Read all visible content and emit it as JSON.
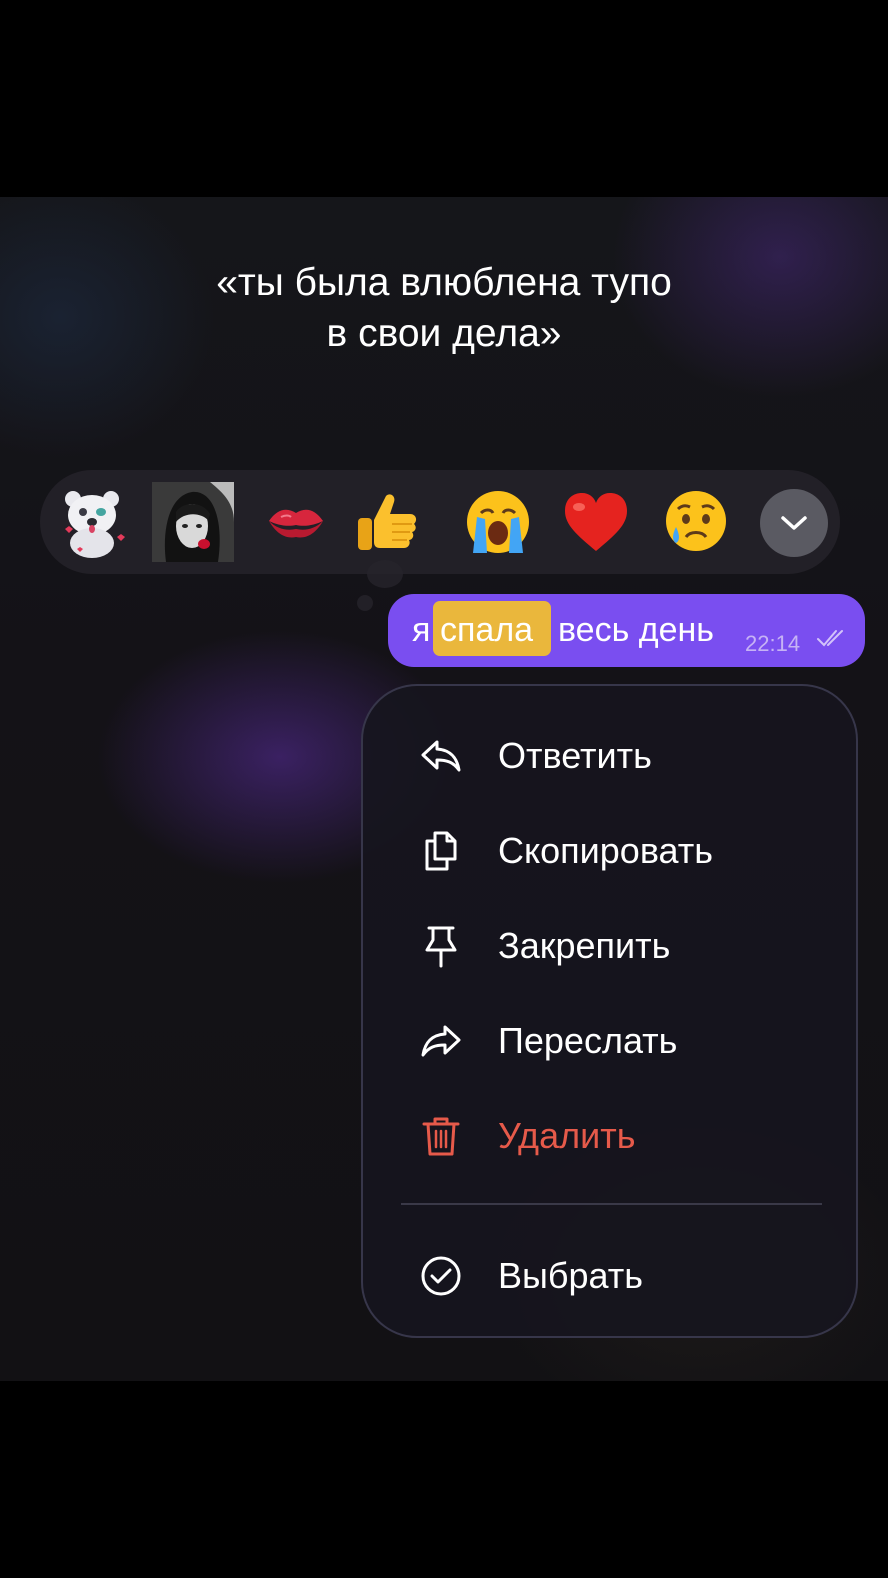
{
  "caption": {
    "line1": "«ты была влюблена тупо",
    "line2": "в свои дела»"
  },
  "reactions": {
    "items": [
      "bear-sticker",
      "photo-sticker",
      "💋",
      "👍",
      "😭",
      "❤️",
      "😢"
    ],
    "more_icon": "chevron-down-icon"
  },
  "message": {
    "word1": "я",
    "highlighted_word": "спала",
    "rest": "весь день",
    "time": "22:14",
    "status": "read",
    "bubble_color": "#7a4ef0",
    "highlight_color": "#eab73c"
  },
  "menu": {
    "items": [
      {
        "label": "Ответить",
        "icon": "reply-icon"
      },
      {
        "label": "Скопировать",
        "icon": "copy-icon"
      },
      {
        "label": "Закрепить",
        "icon": "pin-icon"
      },
      {
        "label": "Переслать",
        "icon": "forward-icon"
      },
      {
        "label": "Удалить",
        "icon": "trash-icon",
        "danger": true
      }
    ],
    "select": {
      "label": "Выбрать",
      "icon": "check-circle-icon"
    },
    "danger_color": "#e65a4a"
  }
}
